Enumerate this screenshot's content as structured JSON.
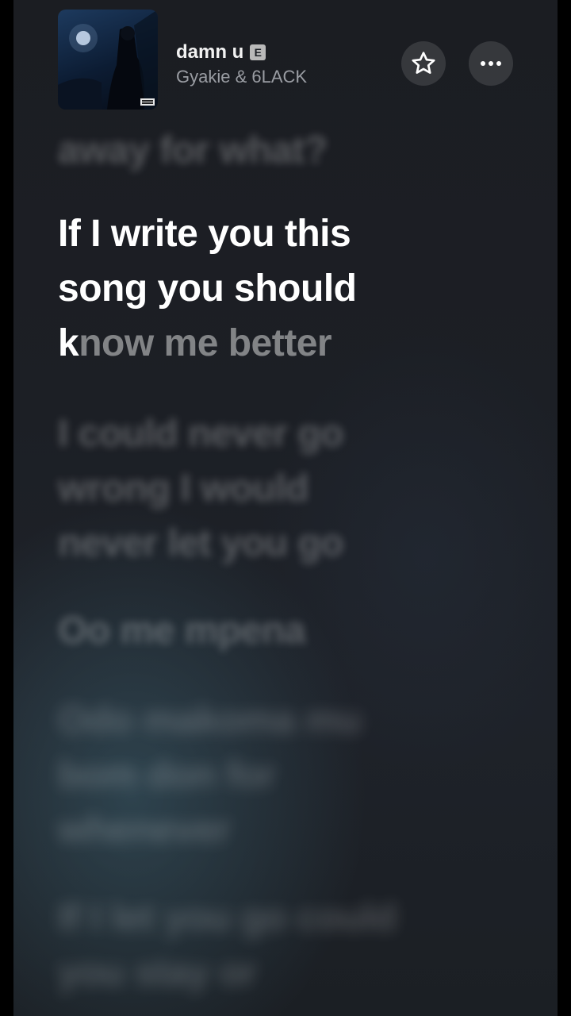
{
  "now_playing": {
    "title": "damn u",
    "explicit_badge": "E",
    "artist": "Gyakie & 6LACK"
  },
  "actions": {
    "favorite_icon": "star-icon",
    "more_icon": "ellipsis-icon"
  },
  "lyrics": {
    "previous_line": "away for what?",
    "current_line": {
      "sung_1": "If I write you this",
      "sung_2": "song you should",
      "sung_3": "k",
      "upcoming": "now me better"
    },
    "next_lines": [
      "I could never go wrong I would never let you go",
      "Oo me mpena",
      "Odo makoma mu bom don for whenever",
      "If I let you go could you stay or"
    ]
  },
  "colors": {
    "background": "#1c1f25",
    "active_lyric": "#ffffff",
    "inactive_lyric": "#6e7075"
  }
}
